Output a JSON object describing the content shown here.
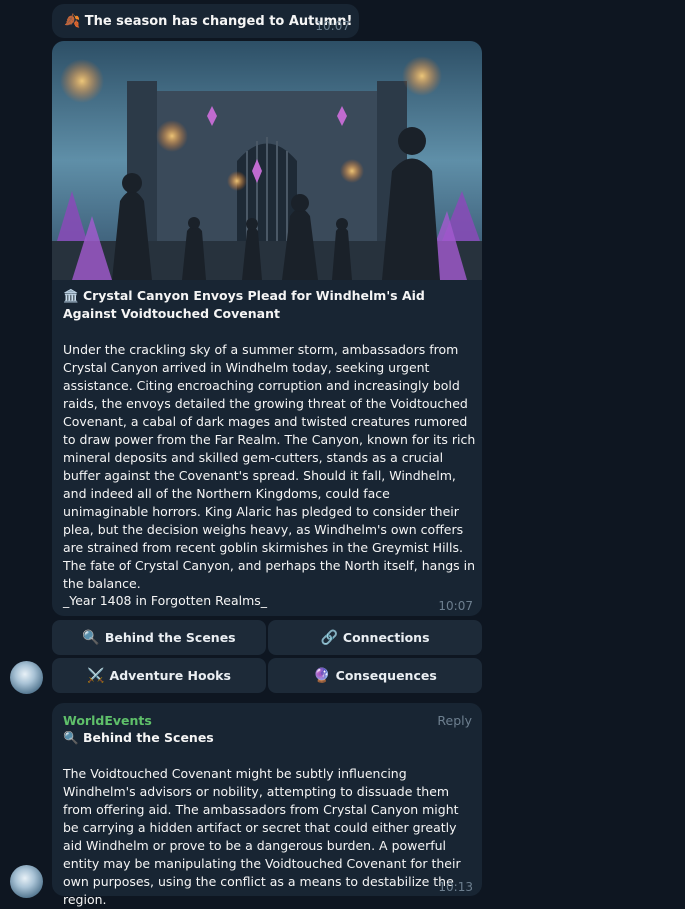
{
  "system_message": {
    "icon": "🍂",
    "text": "The season has changed to Autumn!",
    "time": "10:07"
  },
  "post": {
    "image": "fortress-gate-envoys-image",
    "title_icon": "🏛️",
    "title": "Crystal Canyon Envoys Plead for Windhelm's Aid Against Voidtouched Covenant",
    "body": "Under the crackling sky of a summer storm, ambassadors from Crystal Canyon arrived in Windhelm today, seeking urgent assistance. Citing encroaching corruption and increasingly bold raids, the envoys detailed the growing threat of the Voidtouched Covenant, a cabal of dark mages and twisted creatures rumored to draw power from the Far Realm. The Canyon, known for its rich mineral deposits and skilled gem-cutters, stands as a crucial buffer against the Covenant's spread. Should it fall, Windhelm, and indeed all of the Northern Kingdoms, could face unimaginable horrors. King Alaric has pledged to consider their plea, but the decision weighs heavy, as Windhelm's own coffers are strained from recent goblin skirmishes in the Greymist Hills. The fate of Crystal Canyon, and perhaps the North itself, hangs in the balance.",
    "footer": "_Year 1408 in Forgotten Realms_",
    "time": "10:07"
  },
  "buttons": [
    {
      "icon": "🔍",
      "label": "Behind the Scenes"
    },
    {
      "icon": "🔗",
      "label": "Connections"
    },
    {
      "icon": "⚔️",
      "label": "Adventure Hooks"
    },
    {
      "icon": "🔮",
      "label": "Consequences"
    }
  ],
  "reply": {
    "sender": "WorldEvents",
    "reply_label": "Reply",
    "heading_icon": "🔍",
    "heading": "Behind the Scenes",
    "body": "The Voidtouched Covenant might be subtly influencing Windhelm's advisors or nobility, attempting to dissuade them from offering aid. The ambassadors from Crystal Canyon might be carrying a hidden artifact or secret that could either greatly aid Windhelm or prove to be a dangerous burden. A powerful entity may be manipulating the Voidtouched Covenant for their own purposes, using the conflict as a means to destabilize the region.",
    "time": "10:13"
  },
  "colors": {
    "background": "#0e1621",
    "bubble": "#182533",
    "button": "#1d2a38",
    "sender": "#5fc06a",
    "meta": "#6d7f8f"
  }
}
